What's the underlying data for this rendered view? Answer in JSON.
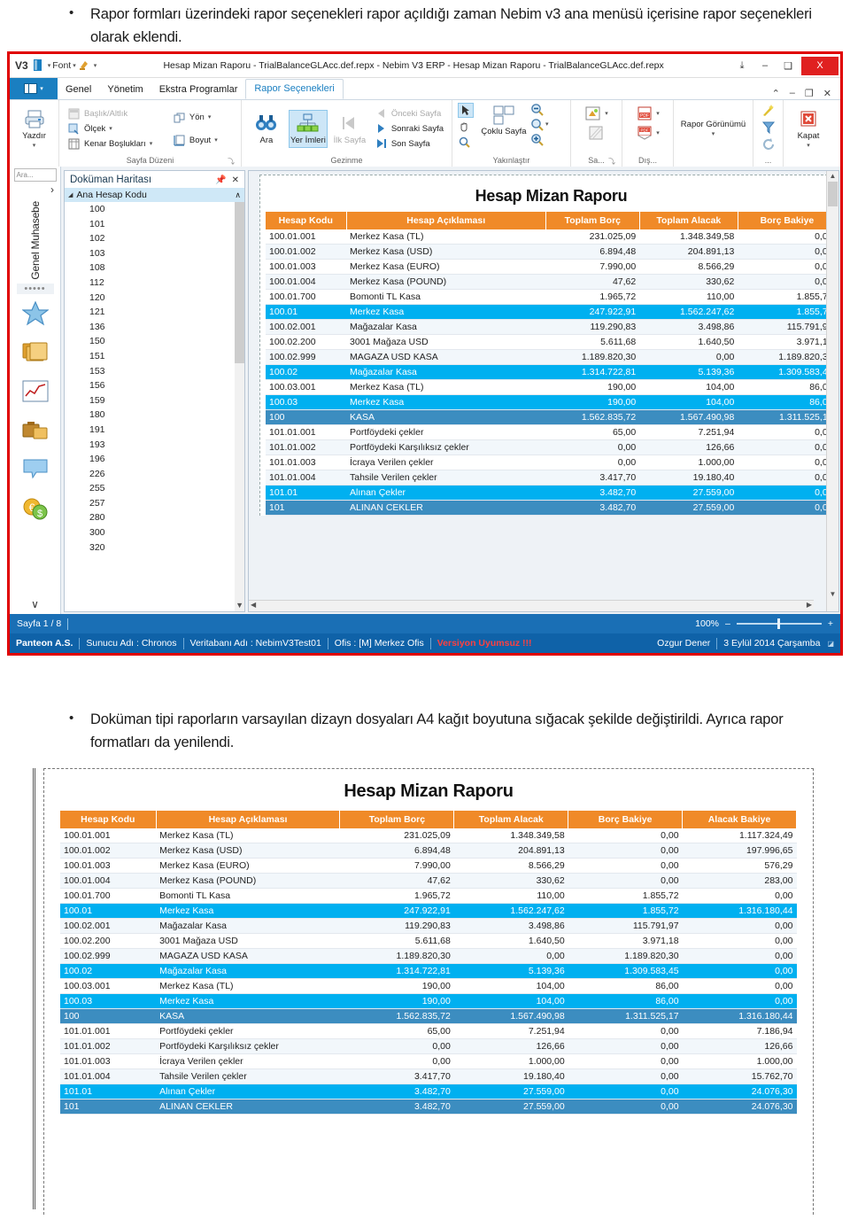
{
  "document": {
    "bullets": [
      "Rapor formları üzerindeki rapor seçenekleri rapor açıldığı zaman Nebim v3 ana menüsü içerisine rapor seçenekleri olarak eklendi.",
      "Doküman tipi raporların varsayılan dizayn dosyaları A4 kağıt boyutuna sığacak şekilde değiştirildi. Ayrıca rapor formatları da yenilendi."
    ],
    "bullet_glyph": "•"
  },
  "colors": {
    "header_orange": "#F08A28",
    "level1_cyan": "#00B0F0",
    "level0_blue": "#3C8DC0",
    "ribbon_blue": "#1A7FC1",
    "statusbar_blue": "#0F62A8",
    "preview_status_blue": "#1A6FB5",
    "highlight_red": "#E00000",
    "warning_red": "#FF4040"
  },
  "app": {
    "titlebar": {
      "logo": "V3",
      "quick_access": [
        "font-dropdown",
        "highlight-dropdown"
      ],
      "font_label": "Font",
      "title": "Hesap Mizan Raporu - TrialBalanceGLAcc.def.repx - Nebim V3 ERP - Hesap Mizan Raporu - TrialBalanceGLAcc.def.repx",
      "restore_label": "⤓",
      "minimize_label": "–",
      "maximize_label": "❑",
      "close_label": "X"
    },
    "ribbon": {
      "tabs": [
        {
          "label": "Genel",
          "active": false
        },
        {
          "label": "Yönetim",
          "active": false
        },
        {
          "label": "Ekstra Programlar",
          "active": false
        },
        {
          "label": "Rapor Seçenekleri",
          "active": true
        }
      ],
      "window_controls": [
        "⌃",
        "–",
        "❐",
        "✕"
      ],
      "groups": [
        {
          "label": "",
          "buttons": [
            {
              "label": "Yazdır",
              "icon": "printer-icon",
              "has_caret": true
            }
          ]
        },
        {
          "label": "Sayfa Düzeni",
          "dialog_launcher": "⤵",
          "small_items": [
            {
              "label": "Başlık/Altlık",
              "icon": "header-footer-icon",
              "dim": true
            },
            {
              "label": "Ölçek",
              "icon": "scale-icon",
              "caret": true
            },
            {
              "label": "Kenar Boşlukları",
              "icon": "margins-icon",
              "caret": true
            },
            {
              "label": "Yön",
              "icon": "orientation-icon",
              "caret": true
            },
            {
              "label": "Boyut",
              "icon": "paper-size-icon",
              "caret": true
            }
          ]
        },
        {
          "label": "Gezinme",
          "buttons": [
            {
              "label": "Ara",
              "icon": "binoculars-icon"
            },
            {
              "label": "Yer İmleri",
              "icon": "bookmarks-icon",
              "selected": true
            },
            {
              "label": "İlk Sayfa",
              "icon": "first-page-icon",
              "dim": true
            }
          ],
          "small_items": [
            {
              "label": "Önceki Sayfa",
              "icon": "previous-page-icon",
              "dim": true
            },
            {
              "label": "Sonraki Sayfa",
              "icon": "next-page-icon"
            },
            {
              "label": "Son Sayfa",
              "icon": "last-page-icon"
            }
          ]
        },
        {
          "label": "Yakınlaştır",
          "tools": [
            {
              "icon": "pointer-icon",
              "selected": true
            },
            {
              "icon": "hand-icon"
            },
            {
              "icon": "magnifier-icon"
            }
          ],
          "buttons": [
            {
              "label": "Çoklu Sayfa",
              "icon": "multi-page-icon",
              "caret": true
            }
          ],
          "zoom_icons": [
            "zoom-out-icon",
            "zoom-level-icon",
            "zoom-in-icon"
          ]
        },
        {
          "label": "Sa...",
          "dialog_launcher": "⤵",
          "icons": [
            "watermark-icon",
            "background-icon"
          ]
        },
        {
          "label": "Dış...",
          "icons": [
            "export-pdf-icon",
            "email-pdf-icon"
          ]
        },
        {
          "label": "",
          "buttons": [
            {
              "label": "Rapor Görünümü",
              "caret": true
            }
          ]
        },
        {
          "label": "...",
          "icons": [
            "wand-icon",
            "filter-icon",
            "refresh-icon"
          ]
        },
        {
          "label": "",
          "buttons": [
            {
              "label": "Kapat",
              "icon": "close-report-icon",
              "has_caret": true
            }
          ]
        }
      ]
    },
    "left_nav": {
      "search_placeholder": "Ara...",
      "expand_arrow": "›",
      "module_label": "Genel Muhasebe",
      "overflow_dots": "•••••",
      "icons": [
        "star-icon",
        "folders-icon",
        "chart-icon",
        "briefcase-icon",
        "message-icon",
        "currency-icon"
      ],
      "collapse_arrow": "∨",
      "drag_dots": "⋮"
    },
    "document_map": {
      "title": "Doküman Haritası",
      "pin_icon": "pin-icon",
      "close_icon": "close-icon",
      "root_label": "Ana Hesap Kodu",
      "root_collapse": "∧",
      "expand_triangle": "◢",
      "items": [
        "100",
        "101",
        "102",
        "103",
        "108",
        "112",
        "120",
        "121",
        "136",
        "150",
        "151",
        "153",
        "156",
        "159",
        "180",
        "191",
        "193",
        "196",
        "226",
        "255",
        "257",
        "280",
        "300",
        "320"
      ]
    },
    "preview_status": {
      "page_label": "Sayfa 1 / 8",
      "zoom_label": "100%",
      "zoom_out": "–",
      "zoom_in": "+"
    },
    "status_bar": {
      "company": "Panteon A.S.",
      "server": "Sunucu Adı : Chronos",
      "database": "Veritabanı Adı : NebimV3Test01",
      "office": "Ofis : [M] Merkez Ofis",
      "warning": "Versiyon Uyumsuz !!!",
      "user": "Ozgur Dener",
      "date": "3 Eylül 2014 Çarşamba"
    }
  },
  "report": {
    "title": "Hesap Mizan Raporu",
    "columns_windowed": [
      "Hesap Kodu",
      "Hesap Açıklaması",
      "Toplam Borç",
      "Toplam Alacak",
      "Borç Bakiye"
    ],
    "columns_full": [
      "Hesap Kodu",
      "Hesap Açıklaması",
      "Toplam Borç",
      "Toplam Alacak",
      "Borç Bakiye",
      "Alacak Bakiye"
    ],
    "rows": [
      {
        "code": "100.01.001",
        "desc": "Merkez Kasa (TL)",
        "debit": "231.025,09",
        "credit": "1.348.349,58",
        "debit_bal": "0,00",
        "credit_bal": "1.117.324,49",
        "level": "leaf"
      },
      {
        "code": "100.01.002",
        "desc": "Merkez Kasa (USD)",
        "debit": "6.894,48",
        "credit": "204.891,13",
        "debit_bal": "0,00",
        "credit_bal": "197.996,65",
        "level": "leaf-alt"
      },
      {
        "code": "100.01.003",
        "desc": "Merkez Kasa (EURO)",
        "debit": "7.990,00",
        "credit": "8.566,29",
        "debit_bal": "0,00",
        "credit_bal": "576,29",
        "level": "leaf"
      },
      {
        "code": "100.01.004",
        "desc": "Merkez Kasa (POUND)",
        "debit": "47,62",
        "credit": "330,62",
        "debit_bal": "0,00",
        "credit_bal": "283,00",
        "level": "leaf-alt"
      },
      {
        "code": "100.01.700",
        "desc": "Bomonti TL Kasa",
        "debit": "1.965,72",
        "credit": "110,00",
        "debit_bal": "1.855,72",
        "credit_bal": "0,00",
        "level": "leaf"
      },
      {
        "code": "100.01",
        "desc": "Merkez Kasa",
        "debit": "247.922,91",
        "credit": "1.562.247,62",
        "debit_bal": "1.855,72",
        "credit_bal": "1.316.180,44",
        "level": "group1"
      },
      {
        "code": "100.02.001",
        "desc": "Mağazalar Kasa",
        "debit": "119.290,83",
        "credit": "3.498,86",
        "debit_bal": "115.791,97",
        "credit_bal": "0,00",
        "level": "leaf-alt"
      },
      {
        "code": "100.02.200",
        "desc": "3001 Mağaza USD",
        "debit": "5.611,68",
        "credit": "1.640,50",
        "debit_bal": "3.971,18",
        "credit_bal": "0,00",
        "level": "leaf"
      },
      {
        "code": "100.02.999",
        "desc": "MAGAZA USD KASA",
        "debit": "1.189.820,30",
        "credit": "0,00",
        "debit_bal": "1.189.820,30",
        "credit_bal": "0,00",
        "level": "leaf-alt"
      },
      {
        "code": "100.02",
        "desc": "Mağazalar Kasa",
        "debit": "1.314.722,81",
        "credit": "5.139,36",
        "debit_bal": "1.309.583,45",
        "credit_bal": "0,00",
        "level": "group1"
      },
      {
        "code": "100.03.001",
        "desc": "Merkez Kasa (TL)",
        "debit": "190,00",
        "credit": "104,00",
        "debit_bal": "86,00",
        "credit_bal": "0,00",
        "level": "leaf"
      },
      {
        "code": "100.03",
        "desc": "Merkez Kasa",
        "debit": "190,00",
        "credit": "104,00",
        "debit_bal": "86,00",
        "credit_bal": "0,00",
        "level": "group1"
      },
      {
        "code": "100",
        "desc": "KASA",
        "debit": "1.562.835,72",
        "credit": "1.567.490,98",
        "debit_bal": "1.311.525,17",
        "credit_bal": "1.316.180,44",
        "level": "group0"
      },
      {
        "code": "101.01.001",
        "desc": "Portföydeki çekler",
        "debit": "65,00",
        "credit": "7.251,94",
        "debit_bal": "0,00",
        "credit_bal": "7.186,94",
        "level": "leaf"
      },
      {
        "code": "101.01.002",
        "desc": "Portföydeki Karşılıksız çekler",
        "debit": "0,00",
        "credit": "126,66",
        "debit_bal": "0,00",
        "credit_bal": "126,66",
        "level": "leaf-alt"
      },
      {
        "code": "101.01.003",
        "desc": "İcraya Verilen çekler",
        "debit": "0,00",
        "credit": "1.000,00",
        "debit_bal": "0,00",
        "credit_bal": "1.000,00",
        "level": "leaf"
      },
      {
        "code": "101.01.004",
        "desc": "Tahsile Verilen çekler",
        "debit": "3.417,70",
        "credit": "19.180,40",
        "debit_bal": "0,00",
        "credit_bal": "15.762,70",
        "level": "leaf-alt"
      },
      {
        "code": "101.01",
        "desc": "Alınan Çekler",
        "debit": "3.482,70",
        "credit": "27.559,00",
        "debit_bal": "0,00",
        "credit_bal": "24.076,30",
        "level": "group1"
      },
      {
        "code": "101",
        "desc": "ALINAN CEKLER",
        "debit": "3.482,70",
        "credit": "27.559,00",
        "debit_bal": "0,00",
        "credit_bal": "24.076,30",
        "level": "group0"
      }
    ]
  }
}
